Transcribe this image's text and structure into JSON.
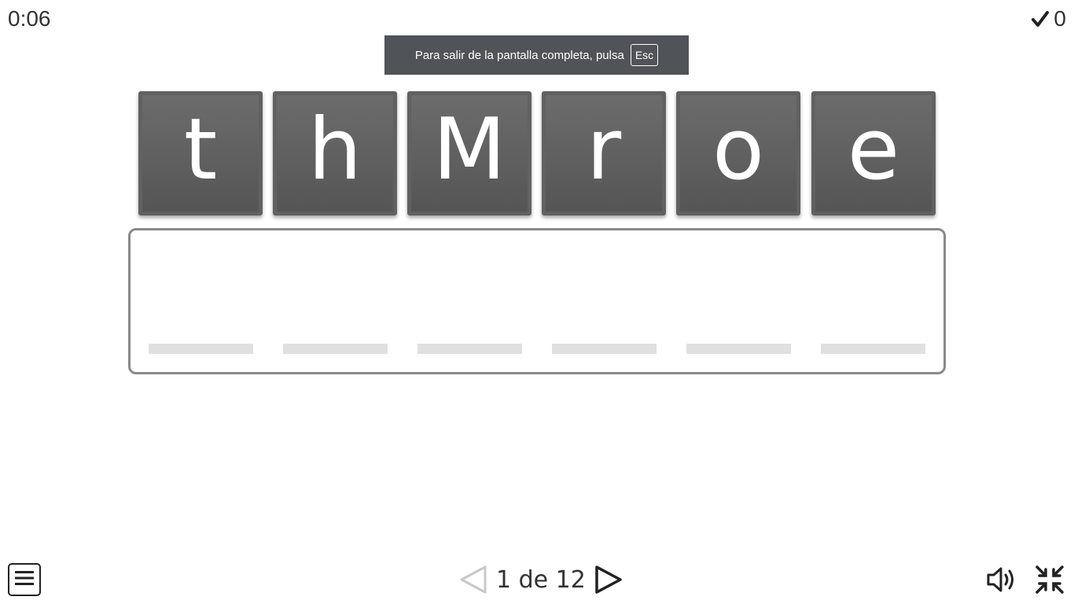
{
  "header": {
    "timer": "0:06",
    "score": "0",
    "score_icon": "check-icon"
  },
  "fullscreen_toast": {
    "message": "Para salir de la pantalla completa, pulsa",
    "key": "Esc"
  },
  "tiles": [
    "t",
    "h",
    "M",
    "r",
    "o",
    "e"
  ],
  "answer": {
    "slots": [
      "",
      "",
      "",
      "",
      "",
      ""
    ]
  },
  "footer": {
    "menu_icon": "menu-icon",
    "page_current": "1",
    "page_label": "1 de 12",
    "prev_icon": "prev-arrow-icon",
    "next_icon": "next-arrow-icon",
    "sound_icon": "speaker-icon",
    "exit_fullscreen_icon": "exit-fullscreen-icon"
  },
  "colors": {
    "tile": "#5f5f5f",
    "tile_text": "#ffffff",
    "slot": "#e0e0e0",
    "border": "#8a8a8a",
    "toast": "#505357"
  }
}
